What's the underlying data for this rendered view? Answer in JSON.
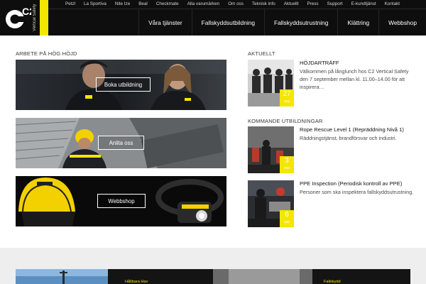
{
  "brand": {
    "logo_text": "C2",
    "logo_sub": "Vertical Safety",
    "accent": "#f3e600"
  },
  "topnav": [
    "Petzl",
    "La Sportiva",
    "Nite Ize",
    "Beal",
    "Checkmate",
    "Alla varumärken",
    "Om oss",
    "Teknisk info",
    "Aktuellt",
    "Press",
    "Support",
    "E-kundtjänst",
    "Kontakt"
  ],
  "mainnav": [
    "Våra tjänster",
    "Fallskyddsutbildning",
    "Fallskyddsutrustning",
    "Klättring",
    "Webbshop"
  ],
  "left": {
    "heading": "ARBETE PÅ HÖG HÖJD",
    "banners": [
      {
        "button": "Boka utbildning"
      },
      {
        "button": "Anlita oss"
      },
      {
        "button": "Webbshop"
      }
    ]
  },
  "right": {
    "news_heading": "AKTUELLT",
    "news": {
      "title": "HÖJDARTRÄFF",
      "text": "Välkommen på långlunch hos C2 Vertical Safety den 7 september mellan kl. 11.00–14.00 för att inspirera…",
      "day": "27",
      "month": "aug"
    },
    "courses_heading": "KOMMANDE UTBILDNINGAR",
    "courses": [
      {
        "title": "Rope Rescue Level 1 (Repräddning Nivå 1)",
        "text": "Räddningstjänst, brandförsvar och industri.",
        "day": "3",
        "month": "sep"
      },
      {
        "title": "PPE Inspection (Periodisk kontroll av PPE)",
        "text": "Personer som ska inspektera fallskyddsutrustning.",
        "day": "6",
        "month": "sep"
      }
    ]
  },
  "bottom": {
    "labels": [
      "Hållbara Hav",
      "Fallskydd"
    ]
  }
}
